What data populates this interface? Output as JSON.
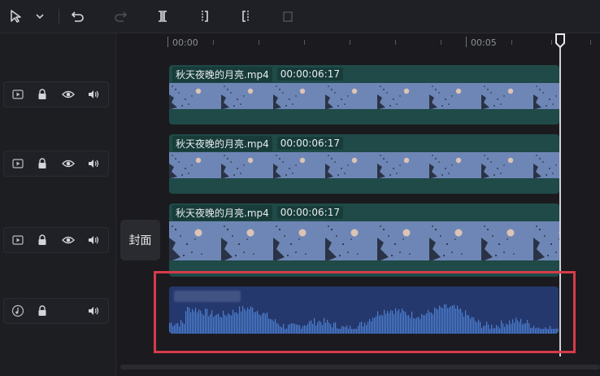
{
  "toolbar": {
    "icons": [
      "pointer-icon",
      "chevron-down-icon",
      "undo-icon",
      "redo-icon",
      "split-icon",
      "split-left-icon",
      "split-right-icon",
      "delete-icon"
    ]
  },
  "ruler": {
    "labels": [
      "00:00",
      "00:05"
    ]
  },
  "tracks": [
    {
      "type": "video",
      "controls": [
        "video-track-icon",
        "lock-icon",
        "eye-icon",
        "volume-icon"
      ],
      "clip_name": "秋天夜晚的月亮.mp4",
      "clip_duration": "00:00:06:17"
    },
    {
      "type": "video",
      "controls": [
        "video-track-icon",
        "lock-icon",
        "eye-icon",
        "volume-icon"
      ],
      "clip_name": "秋天夜晚的月亮.mp4",
      "clip_duration": "00:00:06:17"
    },
    {
      "type": "video",
      "controls": [
        "video-track-icon",
        "lock-icon",
        "eye-icon",
        "volume-icon"
      ],
      "clip_name": "秋天夜晚的月亮.mp4",
      "clip_duration": "00:00:06:17"
    },
    {
      "type": "audio",
      "controls": [
        "music-icon",
        "lock-icon",
        "volume-icon"
      ]
    }
  ],
  "cover_label": "封面",
  "colors": {
    "video_clip": "#1f4a48",
    "audio_clip": "#24386d",
    "waveform": "#4d7fd0",
    "highlight": "#d73b48"
  }
}
